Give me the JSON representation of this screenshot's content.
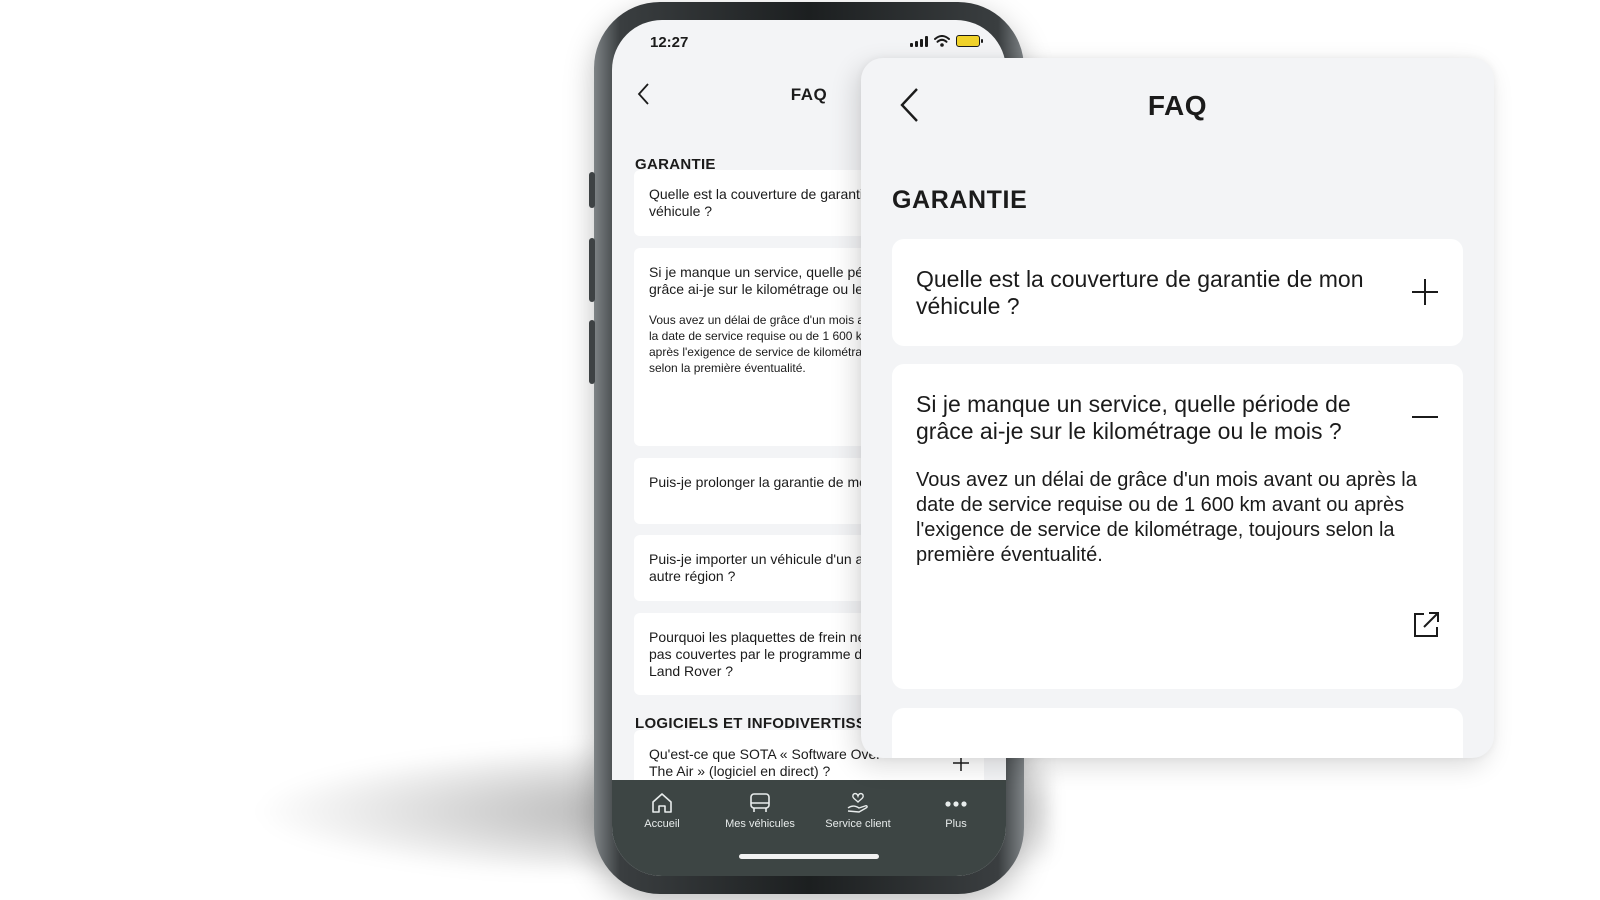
{
  "status": {
    "time": "12:27"
  },
  "screen": {
    "title": "FAQ"
  },
  "sections": [
    {
      "title": "GARANTIE",
      "items": [
        {
          "question": "Quelle est la couverture de garantie de mon véhicule ?",
          "expanded": false
        },
        {
          "question": "Si je manque un service, quelle période de grâce ai-je sur le kilométrage ou le mois ?",
          "expanded": true,
          "answer": "Vous avez un délai de grâce d'un mois avant ou après la date de service requise ou de 1 600 km avant ou après l'exigence de service de kilométrage, toujours selon la première éventualité."
        },
        {
          "question": "Puis-je prolonger la garantie de mon véhicule ?",
          "expanded": false
        },
        {
          "question": "Puis-je importer un véhicule d'un autre pays/une autre région ?",
          "expanded": false
        },
        {
          "question": "Pourquoi les plaquettes de frein ne sont-elles pas couvertes par le programme de garantie de Land Rover ?",
          "expanded": false
        }
      ]
    },
    {
      "title": "LOGICIELS ET INFODIVERTISSEMENT",
      "items": [
        {
          "question": "Qu'est-ce que SOTA « Software Over The Air » (logiciel en direct) ?",
          "expanded": false
        }
      ]
    }
  ],
  "tabs": [
    {
      "label": "Accueil",
      "icon": "home-icon"
    },
    {
      "label": "Mes véhicules",
      "icon": "car-icon"
    },
    {
      "label": "Service client",
      "icon": "care-icon"
    },
    {
      "label": "Plus",
      "icon": "more-icon"
    }
  ],
  "colors": {
    "background": "#f3f4f6",
    "card": "#ffffff",
    "tab_bar": "#3d4544",
    "text": "#1b1b1b",
    "battery": "#f0d22a"
  }
}
